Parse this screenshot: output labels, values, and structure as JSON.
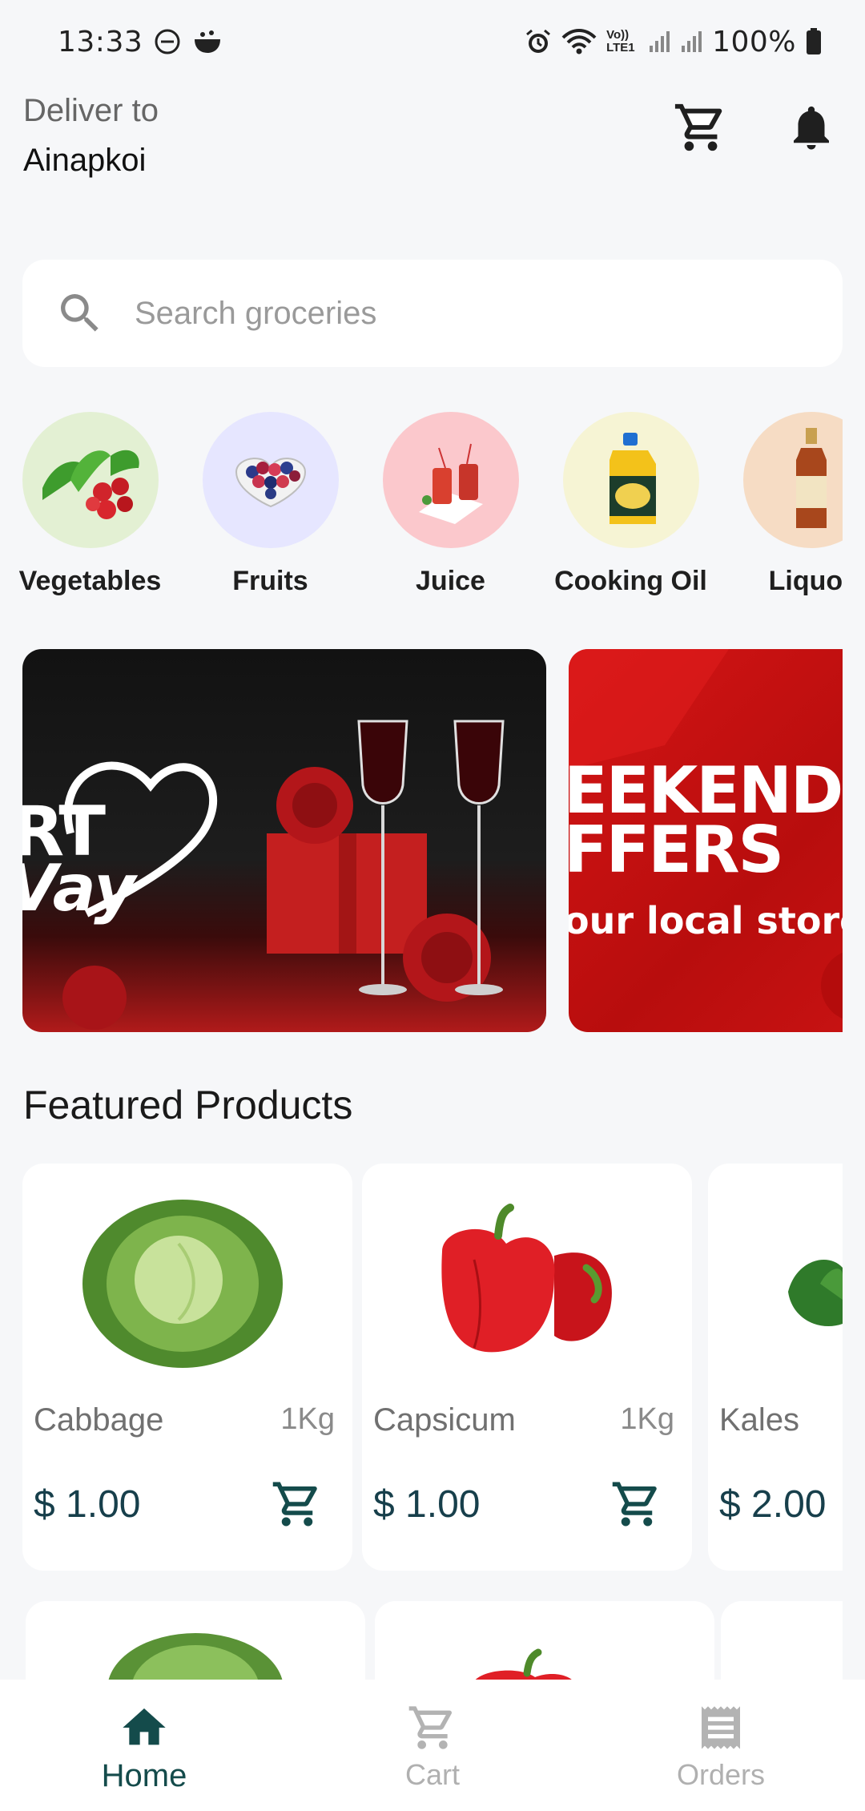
{
  "status_bar": {
    "time": "13:33",
    "battery": "100%",
    "network_label": "Vo)) LTE1"
  },
  "header": {
    "deliver_label": "Deliver to",
    "location": "Ainapkoi",
    "icons": [
      "cart-icon",
      "bell-icon"
    ]
  },
  "search": {
    "placeholder": "Search groceries",
    "icon": "search-icon"
  },
  "categories": [
    {
      "name": "Vegetables",
      "color": "#e3f0d3"
    },
    {
      "name": "Fruits",
      "color": "#e6e6ff"
    },
    {
      "name": "Juice",
      "color": "#fbc8cc"
    },
    {
      "name": "Cooking Oil",
      "color": "#f6f4d4"
    },
    {
      "name": "Liquor",
      "color": "#f6dcc4"
    }
  ],
  "banners": [
    {
      "line1": "RT",
      "line2": "Vay"
    },
    {
      "line1": "EEKEND",
      "line2": "FFERS",
      "line3": "our local store"
    }
  ],
  "featured": {
    "title": "Featured Products",
    "products": [
      {
        "name": "Cabbage",
        "unit": "1Kg",
        "price": "$ 1.00"
      },
      {
        "name": "Capsicum",
        "unit": "1Kg",
        "price": "$ 1.00"
      },
      {
        "name": "Kales",
        "unit": "",
        "price": "$ 2.00"
      }
    ]
  },
  "bottom_nav": {
    "items": [
      {
        "label": "Home",
        "icon": "home-icon",
        "active": true
      },
      {
        "label": "Cart",
        "icon": "cart-icon",
        "active": false
      },
      {
        "label": "Orders",
        "icon": "receipt-icon",
        "active": false
      }
    ]
  },
  "colors": {
    "accent": "#144b4b",
    "price": "#173f4b",
    "background": "#f6f7f9"
  }
}
